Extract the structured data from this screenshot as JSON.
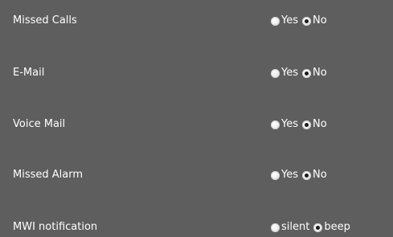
{
  "settings": [
    {
      "label": "Missed Calls",
      "options": [
        {
          "label": "Yes",
          "selected": false
        },
        {
          "label": "No",
          "selected": true
        }
      ]
    },
    {
      "label": "E-Mail",
      "options": [
        {
          "label": "Yes",
          "selected": false
        },
        {
          "label": "No",
          "selected": true
        }
      ]
    },
    {
      "label": "Voice Mail",
      "options": [
        {
          "label": "Yes",
          "selected": false
        },
        {
          "label": "No",
          "selected": true
        }
      ]
    },
    {
      "label": "Missed Alarm",
      "options": [
        {
          "label": "Yes",
          "selected": false
        },
        {
          "label": "No",
          "selected": true
        }
      ]
    },
    {
      "label": "MWI notification",
      "options": [
        {
          "label": "silent",
          "selected": false
        },
        {
          "label": "beep",
          "selected": true
        }
      ]
    }
  ],
  "colors": {
    "background": "#5e5e5e",
    "text": "#ffffff"
  }
}
